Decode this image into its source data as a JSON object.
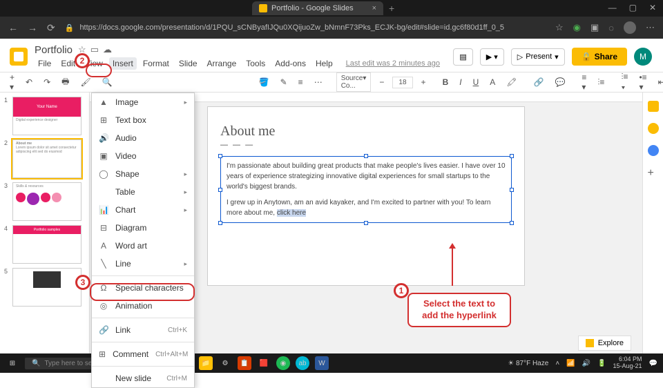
{
  "browser": {
    "tab_title": "Portfolio - Google Slides",
    "url": "https://docs.google.com/presentation/d/1PQU_sCNByafIJQu0XQijuoZw_bNmnF73Pks_ECJK-bg/edit#slide=id.gc6f80d1ff_0_5"
  },
  "doc": {
    "title": "Portfolio",
    "last_edit": "Last edit was 2 minutes ago"
  },
  "menus": [
    "File",
    "Edit",
    "View",
    "Insert",
    "Format",
    "Slide",
    "Arrange",
    "Tools",
    "Add-ons",
    "Help"
  ],
  "header_buttons": {
    "present": "Present",
    "share": "Share",
    "avatar": "M"
  },
  "toolbar": {
    "font": "Source Co...",
    "size": "18"
  },
  "insert_menu": {
    "image": "Image",
    "textbox": "Text box",
    "audio": "Audio",
    "video": "Video",
    "shape": "Shape",
    "table": "Table",
    "chart": "Chart",
    "diagram": "Diagram",
    "wordart": "Word art",
    "line": "Line",
    "special": "Special characters",
    "animation": "Animation",
    "link": "Link",
    "link_shortcut": "Ctrl+K",
    "comment": "Comment",
    "comment_shortcut": "Ctrl+Alt+M",
    "newslide": "New slide",
    "newslide_shortcut": "Ctrl+M"
  },
  "slide": {
    "title": "About me",
    "dashes": "— — —",
    "para1": "I'm passionate about building great products that make people's lives easier. I have over 10 years of experience strategizing innovative digital experiences for small startups to the world's biggest brands.",
    "para2_pre": "I grew up in Anytown, am an avid kayaker, and I'm excited to partner with you! To learn more about me, ",
    "para2_hl": "click here"
  },
  "thumbs": {
    "t1": "Your Name",
    "t1_sub": "Digital experience designer",
    "t2": "About me",
    "t3": "Skills & resources",
    "t4": "Portfolio samples"
  },
  "annotations": {
    "n1": "1",
    "n2": "2",
    "n3": "3",
    "text1": "Select the text to add the hyperlink"
  },
  "explore": "Explore",
  "taskbar": {
    "search": "Type here to search",
    "weather": "87°F Haze",
    "time": "6:04 PM",
    "date": "15-Aug-21"
  }
}
